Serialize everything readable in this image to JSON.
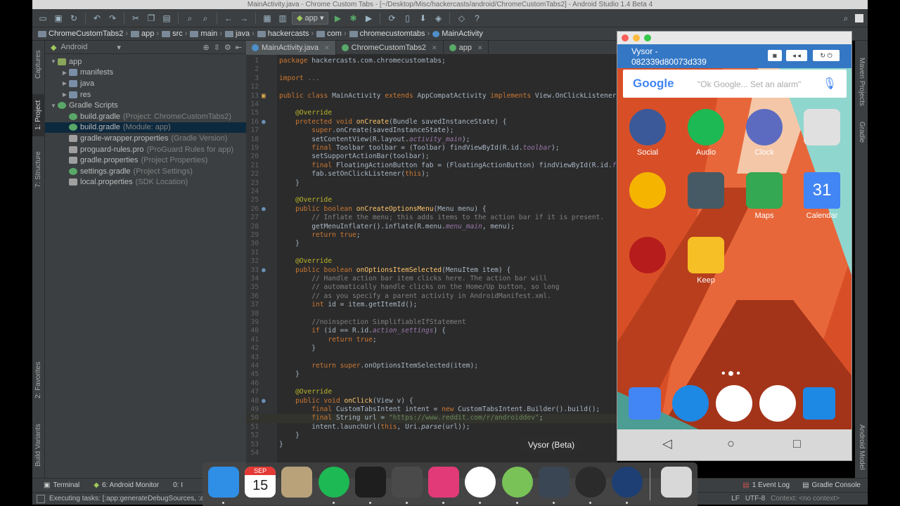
{
  "window": {
    "title": "MainActivity.java - Chrome Custom Tabs - [~/Desktop/Misc/hackercasts/android/ChromeCustomTabs2] - Android Studio 1.4 Beta 4"
  },
  "toolbar": {
    "run_config": "app"
  },
  "breadcrumb": [
    "ChromeCustomTabs2",
    "app",
    "src",
    "main",
    "java",
    "hackercasts",
    "com",
    "chromecustomtabs",
    "MainActivity"
  ],
  "left_strip": {
    "captures": "Captures",
    "project": "1: Project",
    "structure": "7: Structure",
    "favorites": "2: Favorites",
    "build_variants": "Build Variants"
  },
  "right_strip": {
    "maven": "Maven Projects",
    "gradle": "Gradle",
    "android_model": "Android Model"
  },
  "project_panel": {
    "view_mode": "Android",
    "tree": [
      {
        "label": "app",
        "hint": "",
        "depth": 0,
        "expanded": true,
        "icon": "module"
      },
      {
        "label": "manifests",
        "hint": "",
        "depth": 1,
        "expanded": false,
        "icon": "folder"
      },
      {
        "label": "java",
        "hint": "",
        "depth": 1,
        "expanded": false,
        "icon": "folder"
      },
      {
        "label": "res",
        "hint": "",
        "depth": 1,
        "expanded": false,
        "icon": "folder"
      },
      {
        "label": "Gradle Scripts",
        "hint": "",
        "depth": 0,
        "expanded": true,
        "icon": "gradle"
      },
      {
        "label": "build.gradle",
        "hint": "(Project: ChromeCustomTabs2)",
        "depth": 1,
        "icon": "gradle"
      },
      {
        "label": "build.gradle",
        "hint": "(Module: app)",
        "depth": 1,
        "icon": "gradle",
        "selected": true
      },
      {
        "label": "gradle-wrapper.properties",
        "hint": "(Gradle Version)",
        "depth": 1,
        "icon": "file"
      },
      {
        "label": "proguard-rules.pro",
        "hint": "(ProGuard Rules for app)",
        "depth": 1,
        "icon": "file"
      },
      {
        "label": "gradle.properties",
        "hint": "(Project Properties)",
        "depth": 1,
        "icon": "file"
      },
      {
        "label": "settings.gradle",
        "hint": "(Project Settings)",
        "depth": 1,
        "icon": "gradle"
      },
      {
        "label": "local.properties",
        "hint": "(SDK Location)",
        "depth": 1,
        "icon": "file"
      }
    ]
  },
  "editor_tabs": [
    {
      "label": "MainActivity.java",
      "active": true
    },
    {
      "label": "ChromeCustomTabs2",
      "active": false
    },
    {
      "label": "app",
      "active": false
    }
  ],
  "code_lines": [
    {
      "n": "1",
      "h": "<span class='kw'>package</span> hackercasts.com.chromecustomtabs;"
    },
    {
      "n": "2",
      "h": ""
    },
    {
      "n": "3",
      "h": "<span class='kw'>import</span> <span class='cm'>...</span>"
    },
    {
      "n": "12",
      "h": ""
    },
    {
      "n": "13",
      "h": "<span class='kw'>public class</span> MainActivity <span class='kw'>extends</span> AppCompatActivity <span class='kw'>implements</span> View.OnClickListener"
    },
    {
      "n": "14",
      "h": ""
    },
    {
      "n": "15",
      "h": "    <span class='an'>@Override</span>"
    },
    {
      "n": "16",
      "h": "    <span class='kw'>protected void</span> <span class='fn'>onCreate</span>(Bundle savedInstanceState) {"
    },
    {
      "n": "17",
      "h": "        <span class='kw'>super</span>.onCreate(savedInstanceState);"
    },
    {
      "n": "18",
      "h": "        setContentView(R.layout.<span class='it'>activity_main</span>);"
    },
    {
      "n": "19",
      "h": "        <span class='kw'>final</span> Toolbar toolbar = (Toolbar) findViewById(R.id.<span class='it'>toolbar</span>);"
    },
    {
      "n": "20",
      "h": "        setSupportActionBar(toolbar);"
    },
    {
      "n": "21",
      "h": "        <span class='kw'>final</span> FloatingActionButton fab = (FloatingActionButton) findViewById(R.id.<span class='it'>f</span>"
    },
    {
      "n": "22",
      "h": "        fab.setOnClickListener(<span class='kw'>this</span>);"
    },
    {
      "n": "23",
      "h": "    }"
    },
    {
      "n": "24",
      "h": ""
    },
    {
      "n": "25",
      "h": "    <span class='an'>@Override</span>"
    },
    {
      "n": "26",
      "h": "    <span class='kw'>public boolean</span> <span class='fn'>onCreateOptionsMenu</span>(Menu menu) {"
    },
    {
      "n": "27",
      "h": "        <span class='cm'>// Inflate the menu; this adds items to the action bar if it is present.</span>"
    },
    {
      "n": "28",
      "h": "        getMenuInflater().inflate(R.menu.<span class='it'>menu_main</span>, menu);"
    },
    {
      "n": "29",
      "h": "        <span class='kw'>return true</span>;"
    },
    {
      "n": "30",
      "h": "    }"
    },
    {
      "n": "31",
      "h": ""
    },
    {
      "n": "32",
      "h": "    <span class='an'>@Override</span>"
    },
    {
      "n": "33",
      "h": "    <span class='kw'>public boolean</span> <span class='fn'>onOptionsItemSelected</span>(MenuItem item) {"
    },
    {
      "n": "34",
      "h": "        <span class='cm'>// Handle action bar item clicks here. The action bar will</span>"
    },
    {
      "n": "35",
      "h": "        <span class='cm'>// automatically handle clicks on the Home/Up button, so long</span>"
    },
    {
      "n": "36",
      "h": "        <span class='cm'>// as you specify a parent activity in AndroidManifest.xml.</span>"
    },
    {
      "n": "37",
      "h": "        <span class='kw'>int</span> id = item.getItemId();"
    },
    {
      "n": "38",
      "h": ""
    },
    {
      "n": "39",
      "h": "        <span class='cm'>//noinspection SimplifiableIfStatement</span>"
    },
    {
      "n": "40",
      "h": "        <span class='kw'>if</span> (id == R.id.<span class='it'>action_settings</span>) {"
    },
    {
      "n": "41",
      "h": "            <span class='kw'>return true</span>;"
    },
    {
      "n": "42",
      "h": "        }"
    },
    {
      "n": "43",
      "h": ""
    },
    {
      "n": "44",
      "h": "        <span class='kw'>return super</span>.onOptionsItemSelected(item);"
    },
    {
      "n": "45",
      "h": "    }"
    },
    {
      "n": "46",
      "h": ""
    },
    {
      "n": "47",
      "h": "    <span class='an'>@Override</span>"
    },
    {
      "n": "48",
      "h": "    <span class='kw'>public void</span> <span class='fn'>onClick</span>(View v) {"
    },
    {
      "n": "49",
      "h": "        <span class='kw'>final</span> CustomTabsIntent intent = <span class='kw'>new</span> CustomTabsIntent.Builder().build();"
    },
    {
      "n": "50",
      "h": "        <span class='kw'>final</span> String url = <span class='st'>\"https://www.reddit.com/r/androiddev\"</span>;",
      "hl": true
    },
    {
      "n": "51",
      "h": "        intent.launchUrl(<span class='kw'>this</span>, Uri.<span class='sm'>parse</span>(url));"
    },
    {
      "n": "52",
      "h": "    }"
    },
    {
      "n": "53",
      "h": "}"
    },
    {
      "n": "54",
      "h": ""
    }
  ],
  "gutter_markers": [
    "16",
    "26",
    "33",
    "48"
  ],
  "bottom_tools": [
    {
      "label": "Terminal"
    },
    {
      "label": "6: Android Monitor"
    },
    {
      "label": "0: I"
    }
  ],
  "bottom_right_tools": [
    {
      "label": "1 Event Log"
    },
    {
      "label": "Gradle Console"
    }
  ],
  "status": {
    "task": "Executing tasks: [:app:generateDebugSources, :a",
    "line_sep": "LF",
    "encoding": "UTF-8",
    "context": "Context: <no context>"
  },
  "vysor": {
    "title": "Vysor",
    "device_id": "082339d80073d339",
    "search_placeholder": "\"Ok Google... Set an alarm\"",
    "google_logo": "Google",
    "apps": [
      {
        "label": "Social",
        "icon": "facebook-icon",
        "color": "#3b5998"
      },
      {
        "label": "Audio",
        "icon": "spotify-icon",
        "color": "#1db954"
      },
      {
        "label": "Clock",
        "icon": "clock-icon",
        "color": "#5c6bc0"
      },
      {
        "label": "",
        "icon": "play-store-icon",
        "color": "#e0e0e0"
      },
      {
        "label": "",
        "icon": "keep-notes-icon",
        "color": "#f4b400"
      },
      {
        "label": "",
        "icon": "settings-icon",
        "color": "#455a64"
      },
      {
        "label": "Maps",
        "icon": "maps-icon",
        "color": "#34a853"
      },
      {
        "label": "Calendar",
        "icon": "calendar-icon",
        "color": "#4285f4"
      },
      {
        "label": "",
        "icon": "clash-of-clans-icon",
        "color": "#b71c1c"
      },
      {
        "label": "Keep",
        "icon": "keep-icon",
        "color": "#f6bf26"
      }
    ],
    "calendar_day": "31",
    "dock_apps": [
      "inbox-icon",
      "messenger-icon",
      "app-drawer-icon",
      "chrome-icon",
      "phone-icon"
    ]
  },
  "mac_dock": {
    "tooltip": "Vysor (Beta)",
    "calendar_month": "SEP",
    "calendar_day": "15",
    "items": [
      {
        "name": "finder-icon",
        "color": "#2f8ee6"
      },
      {
        "name": "calendar-icon",
        "color": "#ffffff"
      },
      {
        "name": "archive-icon",
        "color": "#b9a27a"
      },
      {
        "name": "spotify-icon",
        "color": "#1db954"
      },
      {
        "name": "terminal-icon",
        "color": "#1e1e1e"
      },
      {
        "name": "sublime-text-icon",
        "color": "#4a4a4a"
      },
      {
        "name": "slack-icon",
        "color": "#e23a78"
      },
      {
        "name": "chrome-icon",
        "color": "#ffffff"
      },
      {
        "name": "android-studio-icon",
        "color": "#78c257"
      },
      {
        "name": "vysor-icon",
        "color": "#3a4654"
      },
      {
        "name": "xcode-instruments-icon",
        "color": "#2b2b2b"
      },
      {
        "name": "quicktime-icon",
        "color": "#1d3f74"
      },
      {
        "name": "trash-icon",
        "color": "#d8d8d8"
      }
    ]
  },
  "colors": {
    "accent": "#3478c5",
    "ide_bg": "#3c3f41",
    "editor_bg": "#2b2b2b",
    "wallpaper": "#cf4a25"
  }
}
